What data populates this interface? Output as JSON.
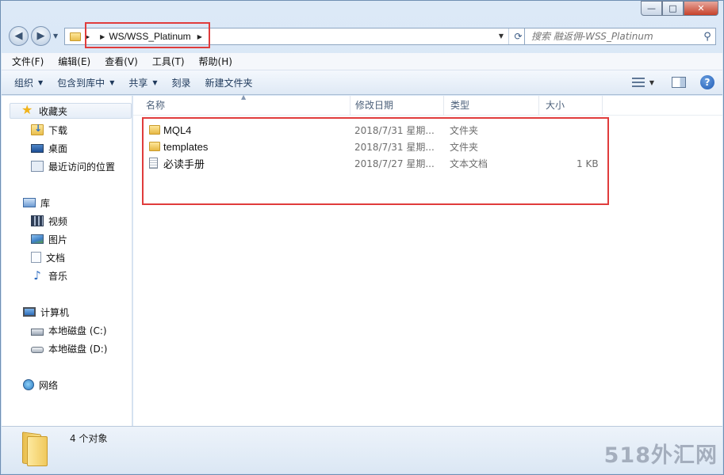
{
  "window": {
    "caption_buttons": {
      "minimize": "—",
      "maximize": "□",
      "close": "✕"
    }
  },
  "address": {
    "segments": [
      "WS/",
      "WSS_Platinum"
    ],
    "search_placeholder": "搜索 融返佣-WSS_Platinum"
  },
  "menu": [
    "文件(F)",
    "编辑(E)",
    "查看(V)",
    "工具(T)",
    "帮助(H)"
  ],
  "toolbar": {
    "organize": "组织",
    "include_in_library": "包含到库中",
    "share": "共享",
    "burn": "刻录",
    "new_folder": "新建文件夹",
    "help": "?"
  },
  "nav": {
    "favorites": "收藏夹",
    "downloads": "下载",
    "desktop": "桌面",
    "recent": "最近访问的位置",
    "libraries": "库",
    "videos": "视频",
    "pictures": "图片",
    "documents": "文档",
    "music": "音乐",
    "computer": "计算机",
    "drive_c": "本地磁盘 (C:)",
    "drive_d": "本地磁盘 (D:)",
    "network": "网络"
  },
  "columns": {
    "name": "名称",
    "date": "修改日期",
    "type": "类型",
    "size": "大小"
  },
  "files": [
    {
      "name": "MQL4",
      "date": "2018/7/31 星期...",
      "type": "文件夹",
      "size": "",
      "icon": "folder-icon"
    },
    {
      "name": "templates",
      "date": "2018/7/31 星期...",
      "type": "文件夹",
      "size": "",
      "icon": "folder-icon"
    },
    {
      "name": "必读手册",
      "date": "2018/7/27 星期...",
      "type": "文本文档",
      "size": "1 KB",
      "icon": "text-file-icon"
    }
  ],
  "status": {
    "count": "4 个对象"
  },
  "watermark": "518外汇网",
  "colors": {
    "highlight": "#e03c3c",
    "window_frame": "#dce9f7"
  }
}
